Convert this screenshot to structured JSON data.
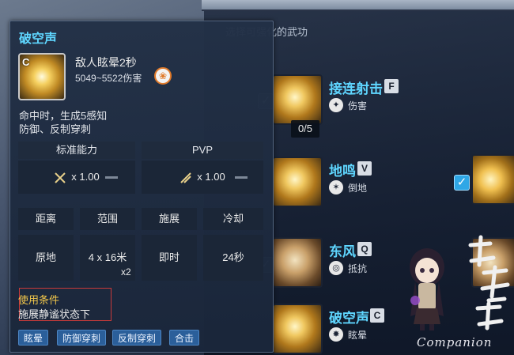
{
  "background_panel": {
    "heading": "选择可强化的武功",
    "skills": [
      {
        "name": "接连射击",
        "key": "F",
        "sub_label": "伤害",
        "count": "0/5"
      },
      {
        "name": "地鸣",
        "key": "V",
        "sub_label": "倒地"
      },
      {
        "name": "东风",
        "key": "Q",
        "sub_label": "抵抗"
      },
      {
        "name": "破空声",
        "key": "C",
        "sub_label": "眩晕"
      }
    ]
  },
  "tooltip": {
    "title": "破空声",
    "icon_letter": "C",
    "effect": "敌人眩晕2秒",
    "damage": "5049~5522伤害",
    "description_line1": "命中时，生成5感知",
    "description_line2": "防御、反制穿刺",
    "headers": {
      "standard": "标准能力",
      "pvp": "PVP"
    },
    "multipliers": {
      "standard": "x 1.00",
      "pvp": "x 1.00"
    },
    "stats": {
      "labels": [
        "距离",
        "范围",
        "施展",
        "冷却"
      ],
      "values": [
        "原地",
        "4 x 16米",
        "即时",
        "24秒"
      ],
      "range_extra": "x2"
    },
    "condition": {
      "title": "使用条件",
      "text": "施展静谧状态下"
    },
    "tags": [
      "眩晕",
      "防御穿刺",
      "反制穿刺",
      "合击"
    ]
  },
  "watermark": {
    "text": "Companion"
  },
  "colors": {
    "accent": "#5fd6ff",
    "condition_title": "#f0c64a",
    "tag_bg": "#2b5f9a",
    "highlight_border": "#c83a3a"
  }
}
